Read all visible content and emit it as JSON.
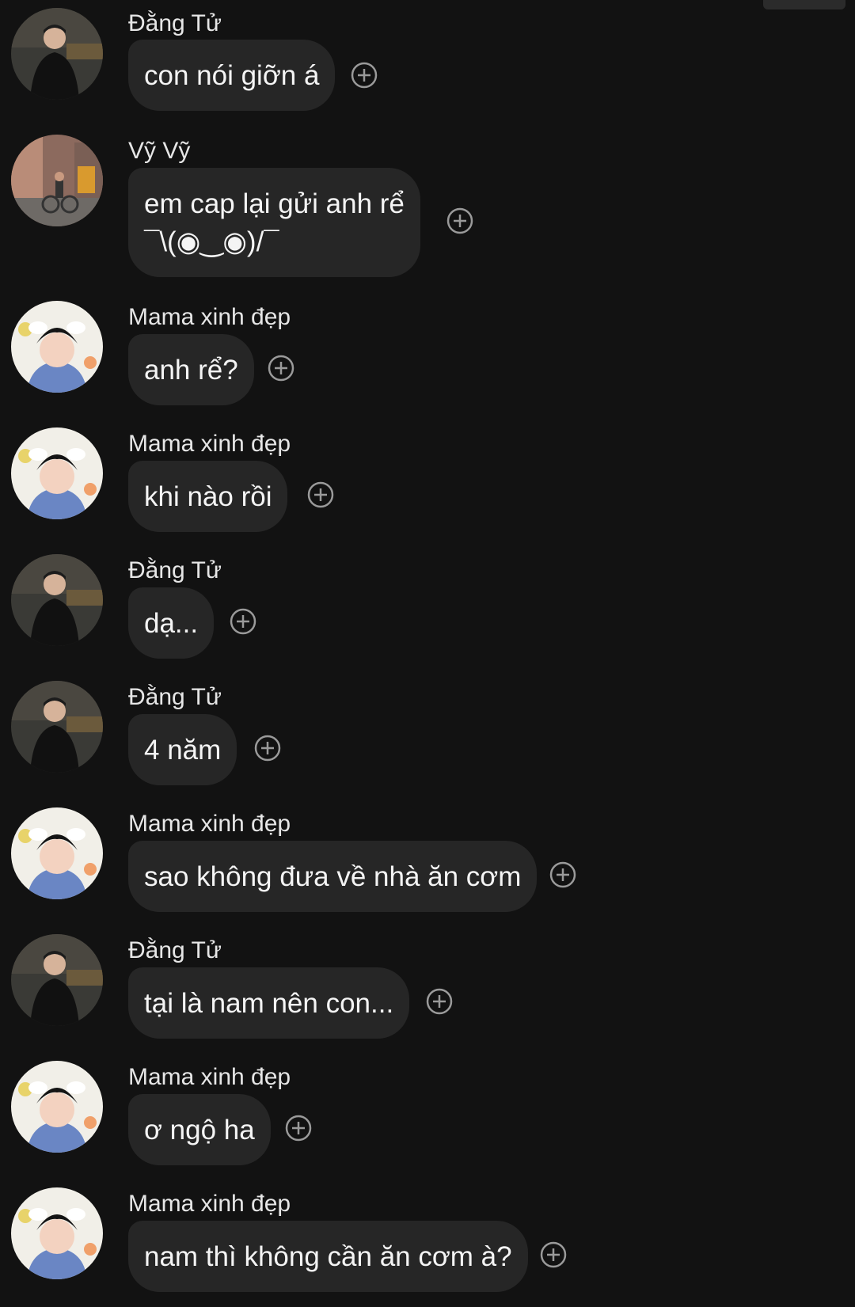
{
  "messages": [
    {
      "sender": "Đằng Tử",
      "text": "con nói giỡn á",
      "avatar": "man-black-shirt-avatar"
    },
    {
      "sender": "Vỹ Vỹ",
      "text": "em cap lại gửi anh rể\n¯\\(◉‿◉)/¯",
      "avatar": "street-bicycle-avatar"
    },
    {
      "sender": "Mama xinh đẹp",
      "text": "anh rể?",
      "avatar": "boy-with-ears-avatar"
    },
    {
      "sender": "Mama xinh đẹp",
      "text": "khi nào rồi",
      "avatar": "boy-with-ears-avatar"
    },
    {
      "sender": "Đằng Tử",
      "text": "dạ...",
      "avatar": "man-black-shirt-avatar"
    },
    {
      "sender": "Đằng Tử",
      "text": "4 năm",
      "avatar": "man-black-shirt-avatar"
    },
    {
      "sender": "Mama xinh đẹp",
      "text": "sao không đưa về nhà ăn cơm",
      "avatar": "boy-with-ears-avatar"
    },
    {
      "sender": "Đằng Tử",
      "text": "tại là nam nên con...",
      "avatar": "man-black-shirt-avatar"
    },
    {
      "sender": "Mama xinh đẹp",
      "text": "ơ ngộ ha",
      "avatar": "boy-with-ears-avatar"
    },
    {
      "sender": "Mama xinh đẹp",
      "text": "nam thì không cần ăn cơm à?",
      "avatar": "boy-with-ears-avatar"
    }
  ],
  "react_icon": "add-reaction-icon",
  "colors": {
    "background": "#121212",
    "bubble": "#262626",
    "text": "#f4f4f4",
    "sender": "#e6e6e6",
    "icon": "#9a9a9a"
  }
}
